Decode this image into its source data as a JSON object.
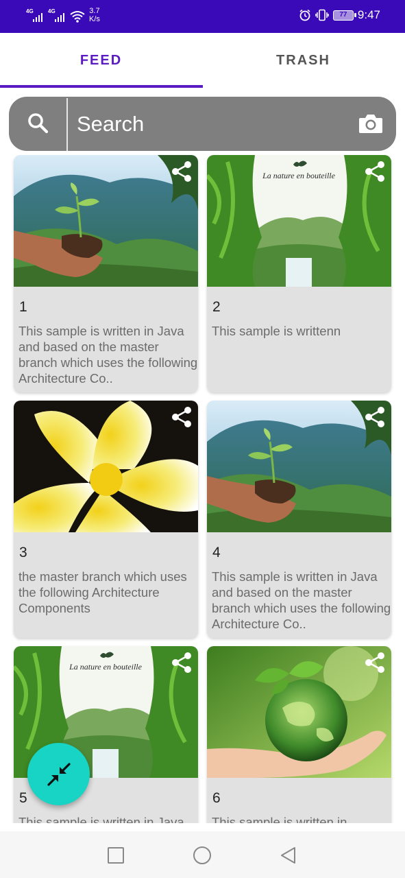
{
  "status_bar": {
    "sim1_label": "4G",
    "sim2_label": "4G",
    "speed_value": "3.7",
    "speed_unit": "K/s",
    "battery": "77",
    "time": "9:47"
  },
  "tabs": [
    {
      "label": "FEED",
      "active": true
    },
    {
      "label": "TRASH",
      "active": false
    }
  ],
  "accent_color": "#5a1bc2",
  "status_bar_color": "#3a0ab8",
  "fab_color": "#17d4c4",
  "search": {
    "placeholder": "Search",
    "left_icon": "search-icon",
    "right_icon": "camera-icon"
  },
  "cards": [
    {
      "number": "1",
      "description": "This sample is written in Java and based on the master branch which uses the following Architecture Co..",
      "image": "seedling-in-hands",
      "icon": "share-icon"
    },
    {
      "number": "2",
      "description": "This sample is writtenn",
      "image": "waterfall-nature-bottle",
      "image_caption": "La nature en bouteille",
      "icon": "share-icon"
    },
    {
      "number": "3",
      "description": "the master branch which uses the following Architecture Components",
      "image": "plumeria-flower",
      "icon": "share-icon"
    },
    {
      "number": "4",
      "description": "This sample is written in Java and based on the master branch which uses the following Architecture Co..",
      "image": "seedling-in-hands",
      "icon": "share-icon"
    },
    {
      "number": "5",
      "description": "This sample is written in Java",
      "image": "waterfall-nature-bottle",
      "image_caption": "La nature en bouteille",
      "icon": "share-icon"
    },
    {
      "number": "6",
      "description": "This sample is written in",
      "image": "green-globe-in-hand",
      "icon": "share-icon"
    }
  ],
  "fab": {
    "icon": "collapse-arrows-icon"
  },
  "nav_bar": {
    "icons": [
      "recents-square-icon",
      "home-circle-icon",
      "back-triangle-icon"
    ]
  }
}
